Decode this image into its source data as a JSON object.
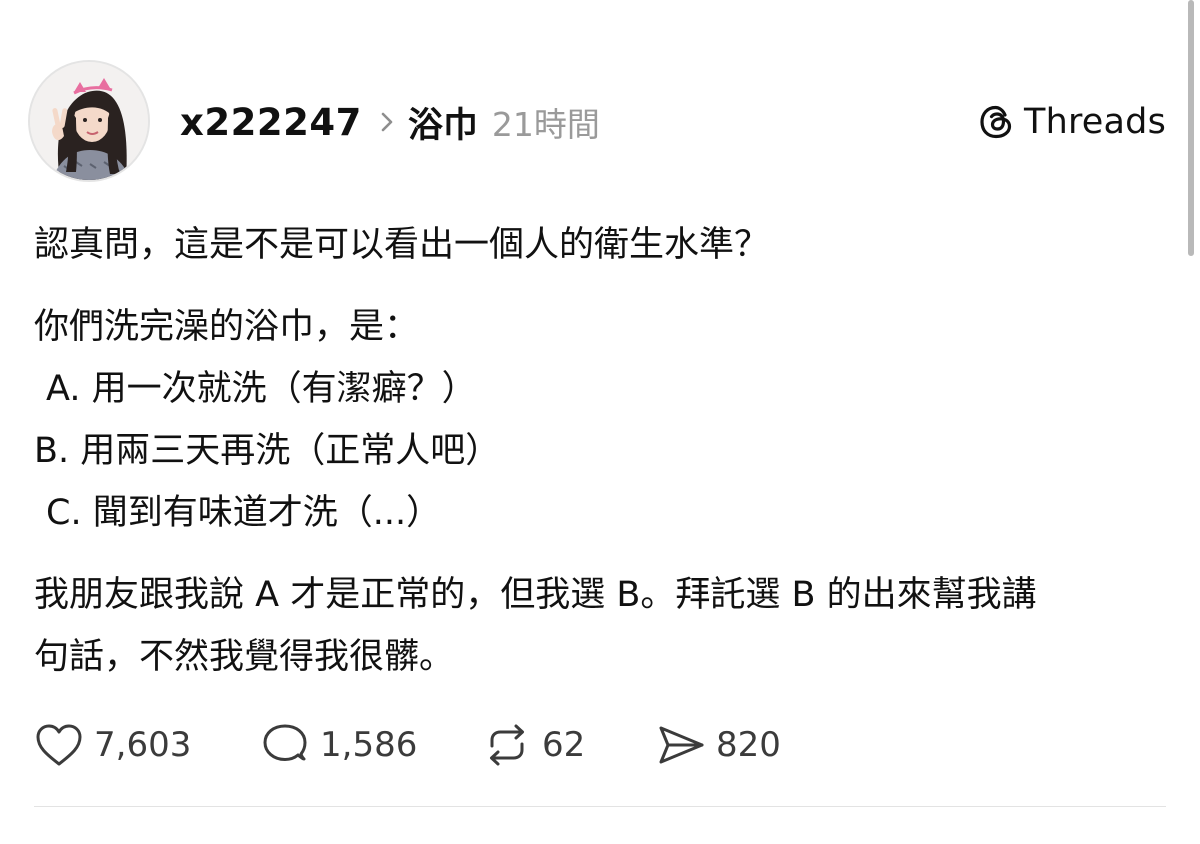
{
  "header": {
    "username": "x222247",
    "topic": "浴巾",
    "time": "21時間",
    "brand": "Threads"
  },
  "post": {
    "line1": "認真問，這是不是可以看出一個人的衛生水準？",
    "line2": "你們洗完澡的浴巾，是：",
    "option_a": "A. 用一次就洗（有潔癖？）",
    "option_b": "B. 用兩三天再洗（正常人吧）",
    "option_c": "C. 聞到有味道才洗（...）",
    "line3": "我朋友跟我說 A 才是正常的，但我選 B。拜託選 B 的出來幫我講",
    "line4": "句話，不然我覺得我很髒。"
  },
  "actions": {
    "likes": "7,603",
    "replies": "1,586",
    "reposts": "62",
    "shares": "820"
  },
  "icons": {
    "avatar": "profile-photo",
    "chevron": "chevron-right-icon",
    "brand": "threads-logo-icon",
    "like": "heart-icon",
    "reply": "speech-bubble-icon",
    "repost": "repost-arrows-icon",
    "share": "send-plane-icon"
  },
  "colors": {
    "text": "#111111",
    "muted": "#9a9a9a",
    "counts": "#3b3b3b",
    "divider": "#e3e3e3"
  }
}
